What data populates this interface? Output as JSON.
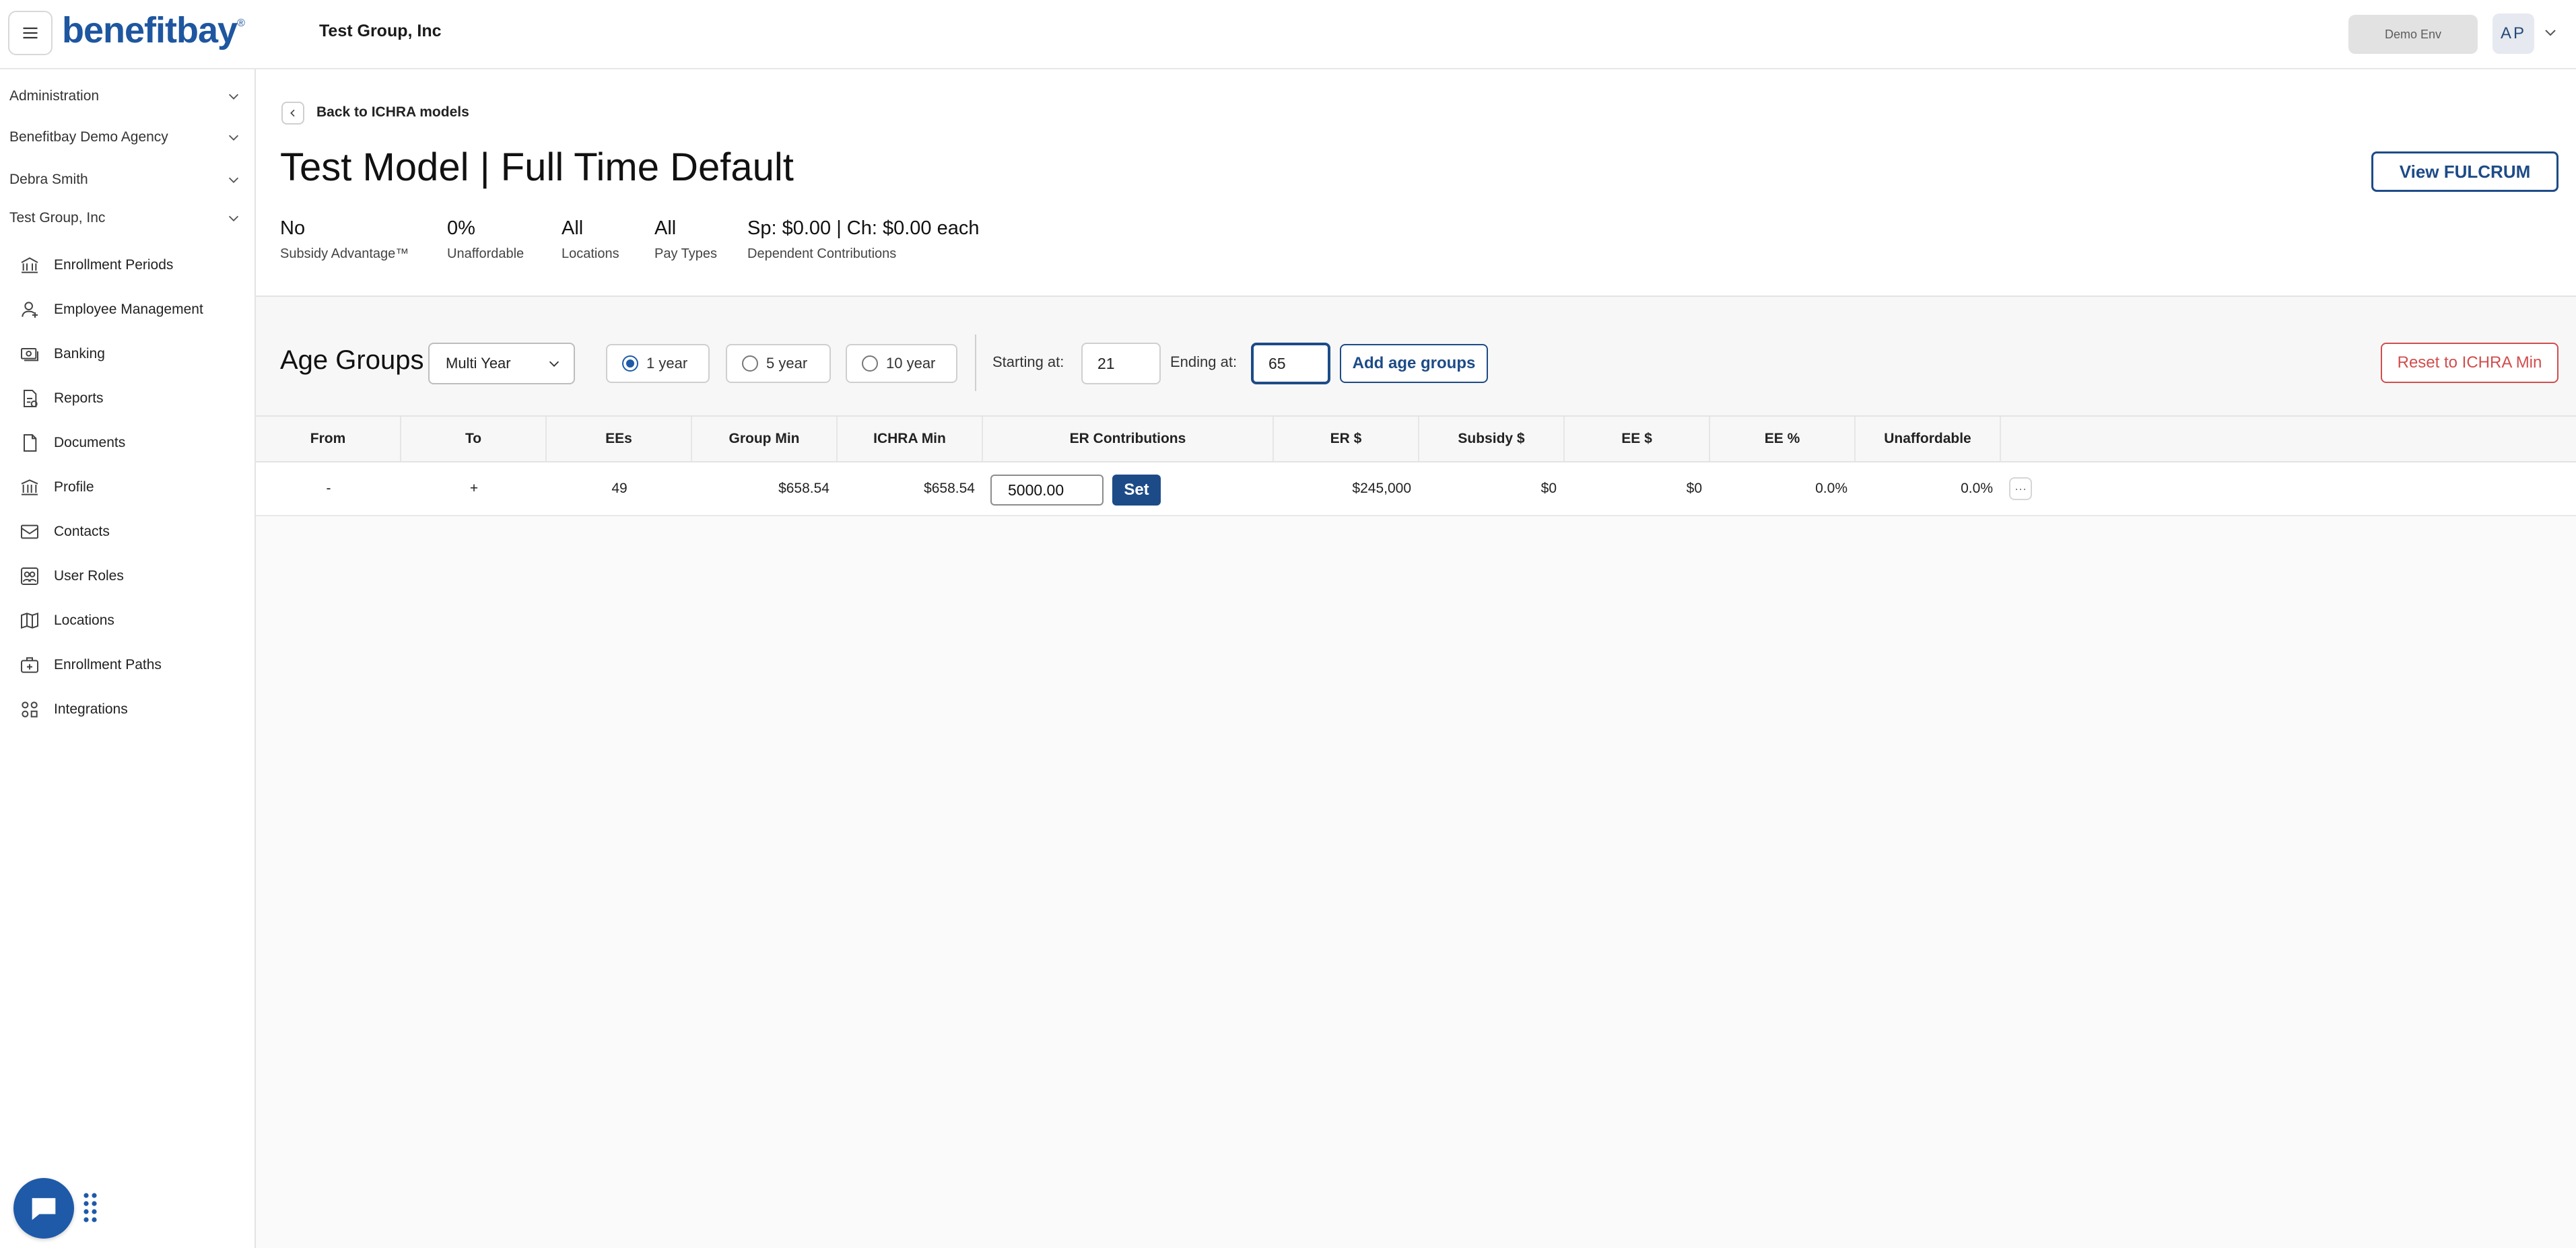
{
  "header": {
    "logo_text": "benefitbay",
    "logo_mark": "®",
    "company": "Test Group, Inc",
    "env_badge": "Demo Env",
    "avatar_initials": "AP"
  },
  "sidebar": {
    "contexts": [
      {
        "label": "Administration"
      },
      {
        "label": "Benefitbay Demo Agency"
      },
      {
        "label": "Debra Smith"
      },
      {
        "label": "Test Group, Inc"
      }
    ],
    "items": [
      {
        "label": "Enrollment Periods",
        "icon": "building-columns-icon"
      },
      {
        "label": "Employee Management",
        "icon": "person-icon"
      },
      {
        "label": "Banking",
        "icon": "money-icon"
      },
      {
        "label": "Reports",
        "icon": "report-icon"
      },
      {
        "label": "Documents",
        "icon": "document-icon"
      },
      {
        "label": "Profile",
        "icon": "institution-icon"
      },
      {
        "label": "Contacts",
        "icon": "envelope-icon"
      },
      {
        "label": "User Roles",
        "icon": "users-icon"
      },
      {
        "label": "Locations",
        "icon": "map-icon"
      },
      {
        "label": "Enrollment Paths",
        "icon": "medical-bag-icon"
      },
      {
        "label": "Integrations",
        "icon": "apps-icon"
      }
    ]
  },
  "page": {
    "back_label": "Back to ICHRA models",
    "title": "Test Model | Full Time Default",
    "view_button": "View FULCRUM",
    "stats": [
      {
        "value": "No",
        "label": "Subsidy Advantage™"
      },
      {
        "value": "0%",
        "label": "Unaffordable"
      },
      {
        "value": "All",
        "label": "Locations"
      },
      {
        "value": "All",
        "label": "Pay Types"
      },
      {
        "value": "Sp: $0.00 | Ch: $0.00 each",
        "label": "Dependent Contributions"
      }
    ]
  },
  "age_groups": {
    "title": "Age Groups",
    "mode_select": "Multi Year",
    "intervals": [
      {
        "label": "1 year",
        "selected": true
      },
      {
        "label": "5 year",
        "selected": false
      },
      {
        "label": "10 year",
        "selected": false
      }
    ],
    "starting_label": "Starting at:",
    "starting_value": "21",
    "ending_label": "Ending at:",
    "ending_value": "65",
    "add_button": "Add age groups",
    "reset_button": "Reset to ICHRA Min"
  },
  "table": {
    "columns": [
      "From",
      "To",
      "EEs",
      "Group Min",
      "ICHRA Min",
      "ER Contributions",
      "ER $",
      "Subsidy $",
      "EE $",
      "EE %",
      "Unaffordable"
    ],
    "rows": [
      {
        "from": "-",
        "to": "+",
        "ees": "49",
        "group_min": "$658.54",
        "ichra_min": "$658.54",
        "er_contribution": "5000.00",
        "set_label": "Set",
        "er_total": "$245,000",
        "subsidy": "$0",
        "ee": "$0",
        "ee_pct": "0.0%",
        "unaffordable": "0.0%",
        "more": "···"
      }
    ]
  },
  "colors": {
    "brand": "#1e56a0",
    "primary_button": "#1d4b87",
    "danger": "#d14d4d"
  }
}
